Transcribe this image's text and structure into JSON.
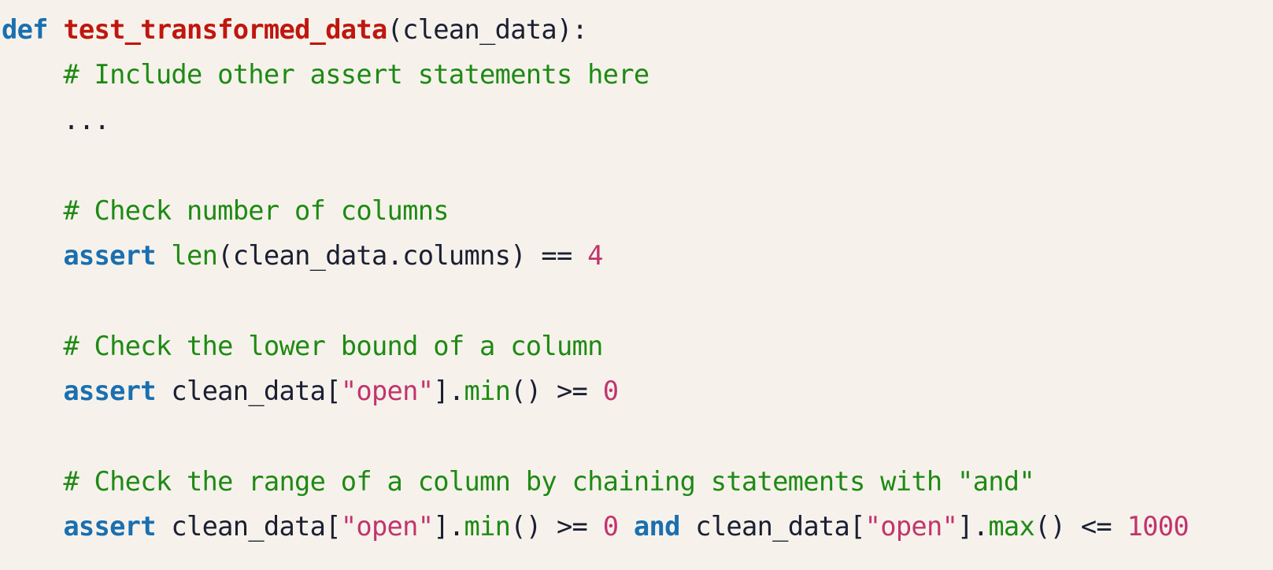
{
  "code": {
    "language": "python",
    "colors": {
      "background": "#f6f2eb",
      "keyword": "#1a6fb0",
      "function_name": "#c0160e",
      "comment": "#1e8a14",
      "string": "#c2346e",
      "number": "#c2346e",
      "builtin_method": "#1e8a14",
      "plain": "#1b1f33"
    },
    "lines": [
      [
        {
          "t": "def",
          "k": "kw"
        },
        {
          "t": " ",
          "k": "pl"
        },
        {
          "t": "test_transformed_data",
          "k": "fn"
        },
        {
          "t": "(clean_data):",
          "k": "pl"
        }
      ],
      [
        {
          "t": "    ",
          "k": "pl"
        },
        {
          "t": "# Include other assert statements here",
          "k": "cm"
        }
      ],
      [
        {
          "t": "    ...",
          "k": "pl"
        }
      ],
      [],
      [
        {
          "t": "    ",
          "k": "pl"
        },
        {
          "t": "# Check number of columns",
          "k": "cm"
        }
      ],
      [
        {
          "t": "    ",
          "k": "pl"
        },
        {
          "t": "assert",
          "k": "kw"
        },
        {
          "t": " ",
          "k": "pl"
        },
        {
          "t": "len",
          "k": "bi"
        },
        {
          "t": "(clean_data.columns) == ",
          "k": "pl"
        },
        {
          "t": "4",
          "k": "nu"
        }
      ],
      [],
      [
        {
          "t": "    ",
          "k": "pl"
        },
        {
          "t": "# Check the lower bound of a column",
          "k": "cm"
        }
      ],
      [
        {
          "t": "    ",
          "k": "pl"
        },
        {
          "t": "assert",
          "k": "kw"
        },
        {
          "t": " clean_data[",
          "k": "pl"
        },
        {
          "t": "\"open\"",
          "k": "st"
        },
        {
          "t": "].",
          "k": "pl"
        },
        {
          "t": "min",
          "k": "bi"
        },
        {
          "t": "() >= ",
          "k": "pl"
        },
        {
          "t": "0",
          "k": "nu"
        }
      ],
      [],
      [
        {
          "t": "    ",
          "k": "pl"
        },
        {
          "t": "# Check the range of a column by chaining statements with \"and\"",
          "k": "cm"
        }
      ],
      [
        {
          "t": "    ",
          "k": "pl"
        },
        {
          "t": "assert",
          "k": "kw"
        },
        {
          "t": " clean_data[",
          "k": "pl"
        },
        {
          "t": "\"open\"",
          "k": "st"
        },
        {
          "t": "].",
          "k": "pl"
        },
        {
          "t": "min",
          "k": "bi"
        },
        {
          "t": "() >= ",
          "k": "pl"
        },
        {
          "t": "0",
          "k": "nu"
        },
        {
          "t": " ",
          "k": "pl"
        },
        {
          "t": "and",
          "k": "kw"
        },
        {
          "t": " clean_data[",
          "k": "pl"
        },
        {
          "t": "\"open\"",
          "k": "st"
        },
        {
          "t": "].",
          "k": "pl"
        },
        {
          "t": "max",
          "k": "bi"
        },
        {
          "t": "() <= ",
          "k": "pl"
        },
        {
          "t": "1000",
          "k": "nu"
        }
      ]
    ]
  }
}
